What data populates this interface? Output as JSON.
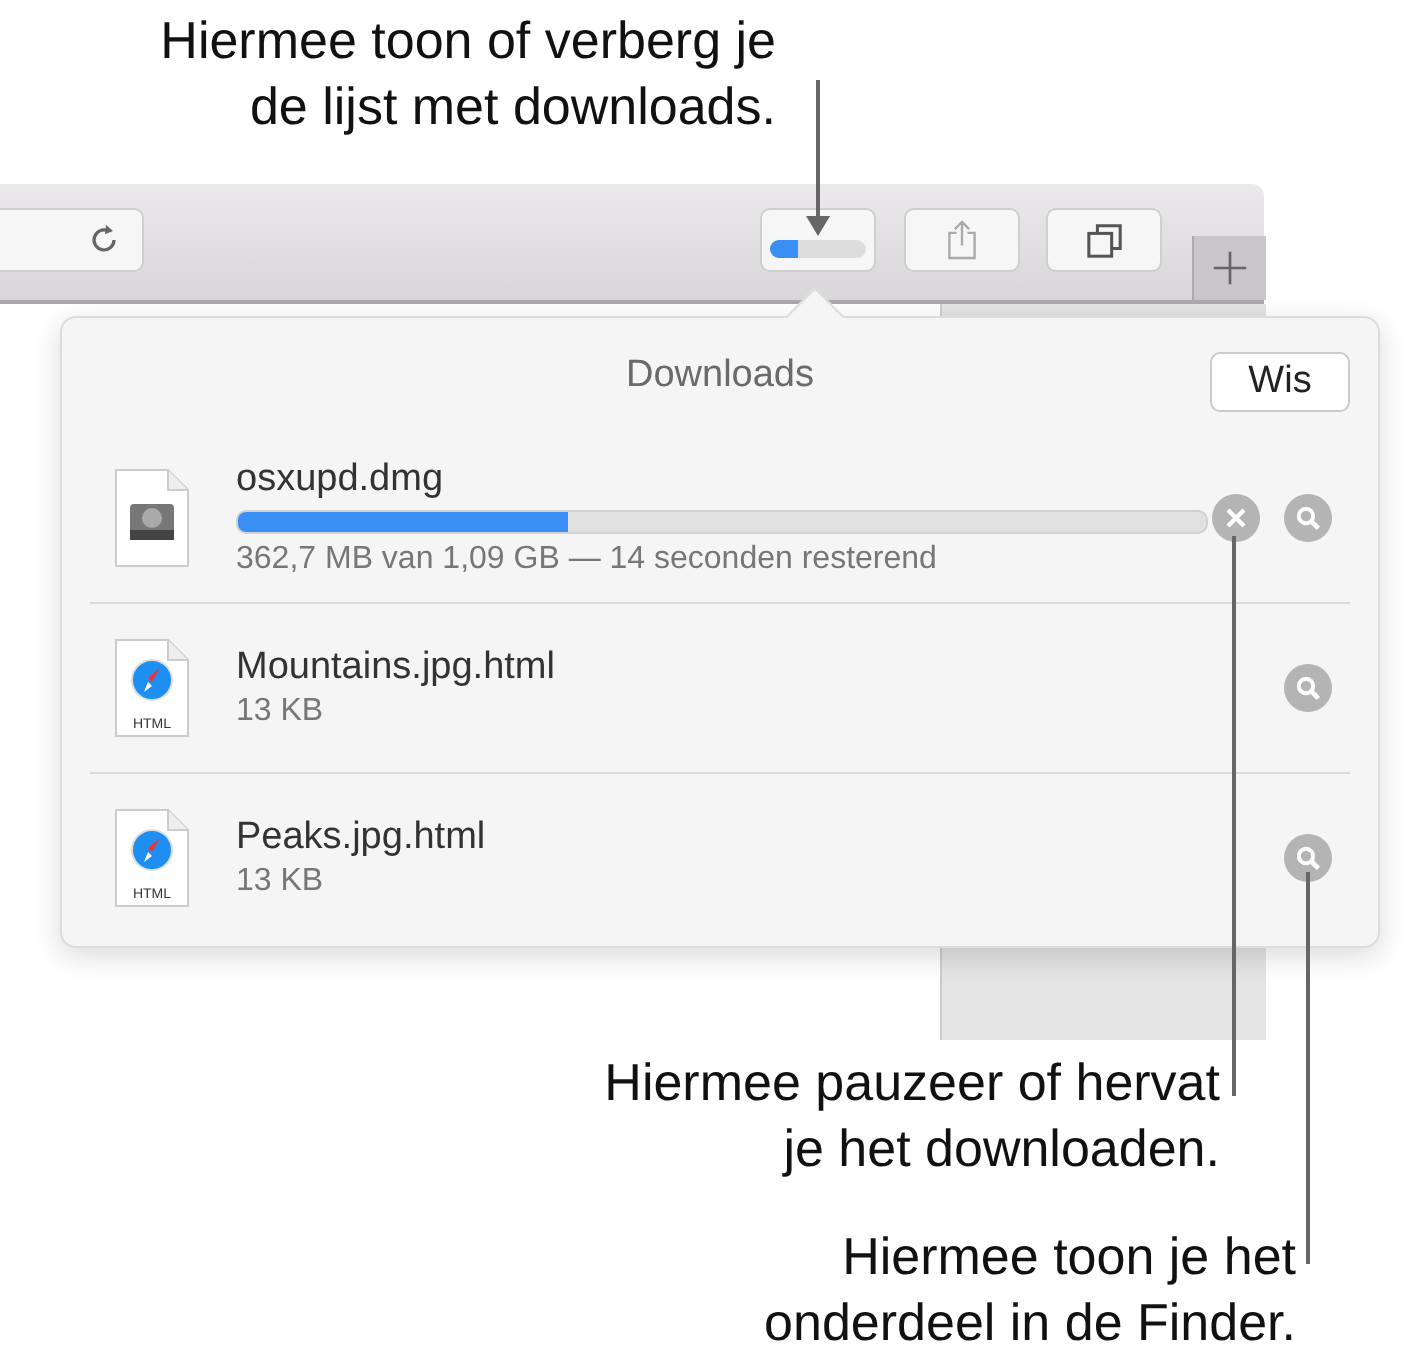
{
  "toolbar": {
    "download_progress": {
      "level": 0.3
    }
  },
  "downloads": {
    "title": "Downloads",
    "clear_button": "Wis",
    "items": [
      {
        "kind": "disk",
        "name": "osxupd.dmg",
        "progress": {
          "level": 0.34
        },
        "detail": "362,7 MB van 1,09 GB — 14 seconden resterend",
        "cancelable": true
      },
      {
        "kind": "html",
        "file_label": "HTML",
        "name": "Mountains.jpg.html",
        "detail": "13 KB",
        "cancelable": false
      },
      {
        "kind": "html",
        "file_label": "HTML",
        "name": "Peaks.jpg.html",
        "detail": "13 KB",
        "cancelable": false
      }
    ]
  },
  "callouts": [
    {
      "text": "Hiermee toon of verberg je\nde lijst met downloads."
    },
    {
      "text": "Hiermee pauzeer of hervat\nje het downloaden."
    },
    {
      "text": "Hiermee toon je het\nonderdeel in de Finder."
    }
  ]
}
